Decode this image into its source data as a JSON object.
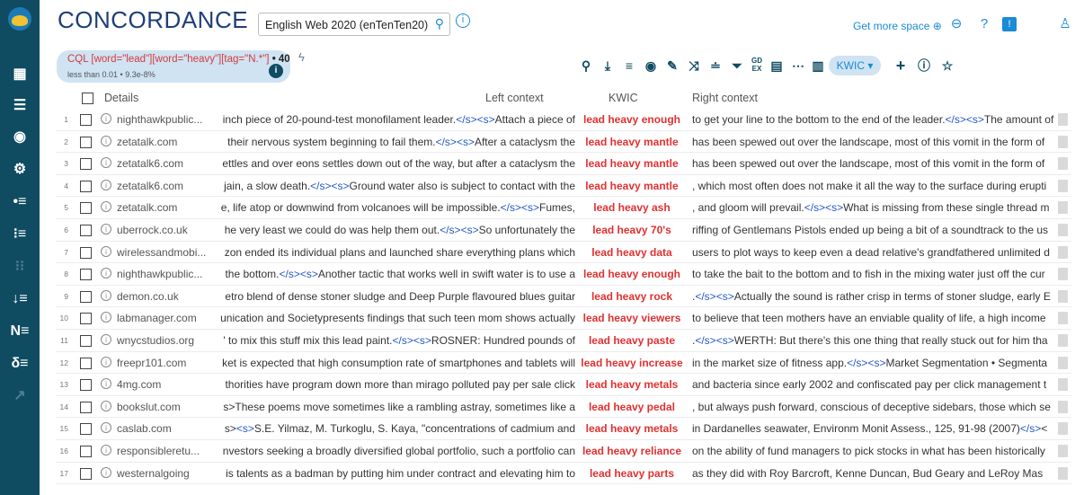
{
  "header": {
    "app_title": "CONCORDANCE",
    "corpus": "English Web 2020 (enTenTen20)",
    "get_more_space": "Get more space",
    "get_more_icon": "plus-circle-icon"
  },
  "query": {
    "cql": "CQL [word=\"lead\"][word=\"heavy\"][tag=\"N.*\"]",
    "count": "• 40",
    "stats": "less than 0.01 • 9.3e-8%",
    "view_mode": "KWIC ▾"
  },
  "sidebar_icons": [
    "logo-icon",
    "dashboard-icon",
    "list-icon",
    "target-icon",
    "settings-icon",
    "bullet-list-icon",
    "parallel-icon",
    "grid-icon",
    "sort-icon",
    "ngram-icon",
    "keyword-icon",
    "trend-icon"
  ],
  "table": {
    "headers": {
      "details": "Details",
      "left": "Left context",
      "kwic": "KWIC",
      "right": "Right context"
    },
    "rows": [
      {
        "num": "1",
        "details": "nighthawkpublic...",
        "left": "inch piece of 20-pound-test monofilament leader.</s><s>Attach a piece of",
        "kwic": "lead heavy enough",
        "right": "to get your line to the bottom to the end of the leader.</s><s>The amount of"
      },
      {
        "num": "2",
        "details": "zetatalk.com",
        "left": "their nervous system beginning to fail them.</s><s>After a cataclysm the",
        "kwic": "lead heavy mantle",
        "right": "has been spewed out over the landscape, most of this vomit in the form of"
      },
      {
        "num": "3",
        "details": "zetatalk6.com",
        "left": "ettles and over eons settles down out of the way, but after a cataclysm the",
        "kwic": "lead heavy mantle",
        "right": "has been spewed out over the landscape, most of this vomit in the form of"
      },
      {
        "num": "4",
        "details": "zetatalk6.com",
        "left": "jain, a slow death.</s><s>Ground water also is subject to contact with the",
        "kwic": "lead heavy mantle",
        "right": ", which most often does not make it all the way to the surface during erupti"
      },
      {
        "num": "5",
        "details": "zetatalk.com",
        "left": "e, life atop or downwind from volcanoes will be impossible.</s><s>Fumes,",
        "kwic": "lead heavy ash",
        "right": ", and gloom will prevail.</s><s>What is missing from these single thread m"
      },
      {
        "num": "6",
        "details": "uberrock.co.uk",
        "left": "he very least we could do was help them out.</s><s>So unfortunately the",
        "kwic": "lead heavy 70's",
        "right": "riffing of Gentlemans Pistols ended up being a bit of a soundtrack to the us"
      },
      {
        "num": "7",
        "details": "wirelessandmobi...",
        "left": "zon ended its individual plans and launched share everything plans which",
        "kwic": "lead heavy data",
        "right": "users to plot ways to keep even a dead relative's grandfathered unlimited d"
      },
      {
        "num": "8",
        "details": "nighthawkpublic...",
        "left": "the bottom.</s><s>Another tactic that works well in swift water is to use a",
        "kwic": "lead heavy enough",
        "right": "to take the bait to the bottom and to fish in the mixing water just off the cur"
      },
      {
        "num": "9",
        "details": "demon.co.uk",
        "left": "etro blend of dense stoner sludge and Deep Purple flavoured blues guitar",
        "kwic": "lead heavy rock",
        "right": ".</s><s>Actually the sound is rather crisp in terms of stoner sludge, early E"
      },
      {
        "num": "10",
        "details": "labmanager.com",
        "left": "unication and Societypresents findings that such teen mom shows actually",
        "kwic": "lead heavy viewers",
        "right": "to believe that teen mothers have an enviable quality of life, a high income"
      },
      {
        "num": "11",
        "details": "wnycstudios.org",
        "left": "' to mix this stuff mix this lead paint.</s><s>ROSNER: Hundred pounds of",
        "kwic": "lead heavy paste",
        "right": ".</s><s>WERTH: But there's this one thing that really stuck out for him tha"
      },
      {
        "num": "12",
        "details": "freepr101.com",
        "left": "ket is expected that high consumption rate of smartphones and tablets will",
        "kwic": "lead heavy increase",
        "right": "in the market size of fitness app.</s><s>Market Segmentation • Segmenta"
      },
      {
        "num": "13",
        "details": "4mg.com",
        "left": "thorities have program down more than mirago polluted pay per sale click",
        "kwic": "lead heavy metals",
        "right": "and bacteria since early 2002 and confiscated pay per click management t"
      },
      {
        "num": "14",
        "details": "bookslut.com",
        "left": "s>These poems move sometimes like a rambling astray, sometimes like a",
        "kwic": "lead heavy pedal",
        "right": ", but always push forward, conscious of deceptive sidebars, those which se"
      },
      {
        "num": "15",
        "details": "caslab.com",
        "left": "s><s>S.E. Yilmaz, M. Turkoglu, S. Kaya, \"concentrations of cadmium and",
        "kwic": "lead heavy metals",
        "right": "in Dardanelles seawater, Environm Monit Assess., 125, 91-98 (2007)</s><"
      },
      {
        "num": "16",
        "details": "responsibleretu...",
        "left": "nvestors seeking a broadly diversified global portfolio, such a portfolio can",
        "kwic": "lead heavy reliance",
        "right": "on the ability of fund managers to pick stocks in what has been historically"
      },
      {
        "num": "17",
        "details": "westernalgoing",
        "left": "is talents as a badman by putting him under contract and elevating him to",
        "kwic": "lead heavy parts",
        "right": "as they did with Roy Barcroft, Kenne Duncan, Bud Geary and LeRoy Mas"
      }
    ]
  }
}
